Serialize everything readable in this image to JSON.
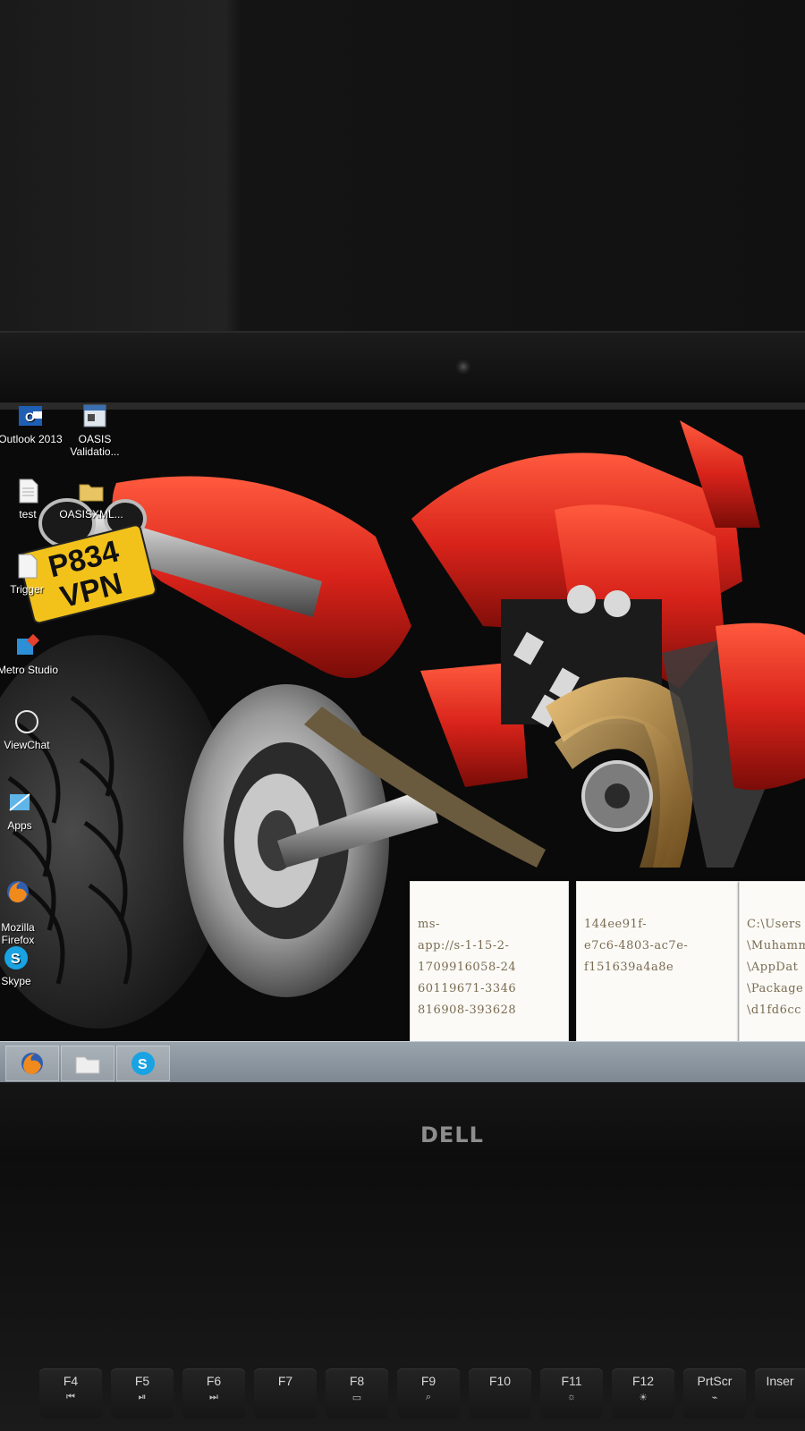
{
  "desktop": {
    "icons": [
      {
        "id": "outlook",
        "label": "Outlook 2013"
      },
      {
        "id": "oasis-validation",
        "label": "OASIS Validatio..."
      },
      {
        "id": "test",
        "label": "test"
      },
      {
        "id": "oasisxml",
        "label": "OASISXML..."
      },
      {
        "id": "trigger",
        "label": "Trigger"
      },
      {
        "id": "metro-studio",
        "label": "Metro Studio"
      },
      {
        "id": "viewchat",
        "label": "ViewChat"
      },
      {
        "id": "apps",
        "label": "Apps"
      },
      {
        "id": "firefox",
        "label": "Mozilla\nFirefox"
      },
      {
        "id": "skype",
        "label": "Skype"
      }
    ],
    "wallpaper": {
      "plate_line1": "P834",
      "plate_line2": "VPN"
    },
    "notes": [
      {
        "id": "note-1",
        "text": "ms-\napp://s-1-15-2-\n1709916058-24\n60119671-3346\n816908-393628"
      },
      {
        "id": "note-2",
        "text": "144ee91f-\ne7c6-4803-ac7e-\nf151639a4a8e"
      },
      {
        "id": "note-3",
        "text": "C:\\Users\n\\Muhamm\n\\AppDat\n\\Package\n\\d1fd6cc"
      }
    ]
  },
  "taskbar": {
    "buttons": [
      {
        "id": "firefox",
        "icon": "firefox-icon"
      },
      {
        "id": "explorer",
        "icon": "folder-icon"
      },
      {
        "id": "skype",
        "icon": "skype-icon",
        "glyph": "S"
      }
    ]
  },
  "laptop": {
    "brand": "DELL",
    "keys": [
      {
        "label": "F4",
        "glyph": "⏮"
      },
      {
        "label": "F5",
        "glyph": "⏯"
      },
      {
        "label": "F6",
        "glyph": "⏭"
      },
      {
        "label": "F7",
        "glyph": ""
      },
      {
        "label": "F8",
        "glyph": "▭"
      },
      {
        "label": "F9",
        "glyph": "⌕"
      },
      {
        "label": "F10",
        "glyph": ""
      },
      {
        "label": "F11",
        "glyph": "☼"
      },
      {
        "label": "F12",
        "glyph": "☀"
      },
      {
        "label": "PrtScr",
        "glyph": "⌁"
      },
      {
        "label": "Inser",
        "glyph": ""
      }
    ]
  },
  "colors": {
    "bike_red": "#d8231a",
    "plate_yellow": "#f2c21b",
    "taskbar": "#8a949d"
  }
}
